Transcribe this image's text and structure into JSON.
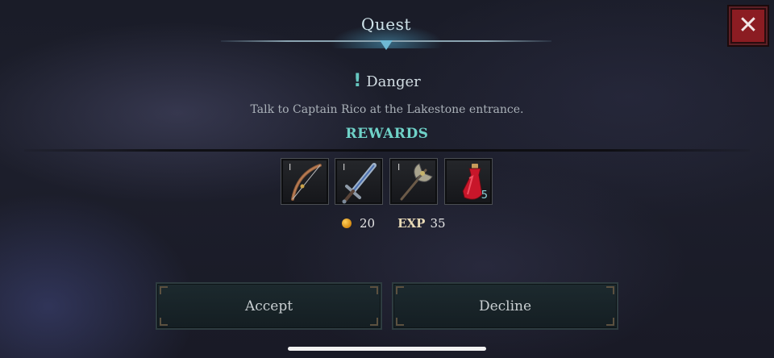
{
  "header": {
    "title": "Quest"
  },
  "close": {
    "icon": "close-icon"
  },
  "quest": {
    "danger_icon": "!",
    "danger_label": "Danger",
    "description": "Talk to Captain Rico at the Lakestone entrance."
  },
  "rewards": {
    "title": "REWARDS",
    "items": [
      {
        "icon": "bow-icon",
        "tier": "Ⅰ"
      },
      {
        "icon": "greatsword-icon",
        "tier": "Ⅰ"
      },
      {
        "icon": "battle-axe-icon",
        "tier": "Ⅰ"
      },
      {
        "icon": "health-potion-icon",
        "quantity": "5"
      }
    ],
    "gold": "20",
    "exp_label": "EXP",
    "exp_value": "35"
  },
  "buttons": {
    "accept": "Accept",
    "decline": "Decline"
  },
  "colors": {
    "accent_teal": "#6fd2c8",
    "close_red": "#8b1c22",
    "gold": "#d58a12"
  }
}
